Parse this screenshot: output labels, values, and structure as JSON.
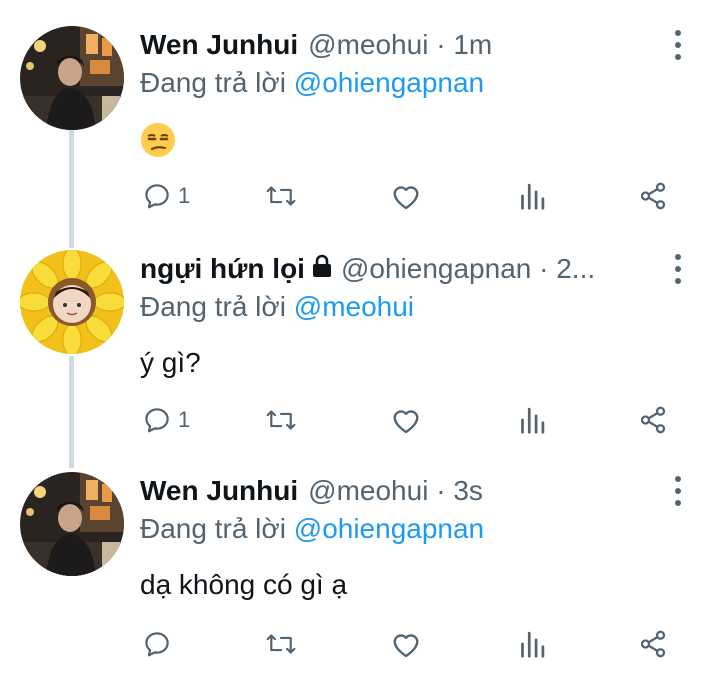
{
  "replying_prefix": "Đang trả lời",
  "tweets": [
    {
      "display_name": "Wen Junhui",
      "handle": "@meohui",
      "time": "1m",
      "reply_to": "@ohiengapnan",
      "text": "",
      "emoji": "unamused-face",
      "reply_count": "1",
      "avatar": "person-night-street"
    },
    {
      "display_name": "ngựi hứn lọi",
      "locked": true,
      "handle": "@ohiengapnan · 2...",
      "time": "",
      "reply_to": "@meohui",
      "text": "ý gì?",
      "reply_count": "1",
      "avatar": "sunflower-face"
    },
    {
      "display_name": "Wen Junhui",
      "handle": "@meohui",
      "time": "3s",
      "reply_to": "@ohiengapnan",
      "text": "dạ không có gì ạ",
      "reply_count": "",
      "avatar": "person-night-street"
    }
  ],
  "colors": {
    "link": "#1d9bf0",
    "secondary": "#536471",
    "thread_line": "#cfd9de"
  },
  "icons": [
    "reply-icon",
    "retweet-icon",
    "like-icon",
    "views-icon",
    "share-icon",
    "more-icon",
    "lock-icon"
  ]
}
